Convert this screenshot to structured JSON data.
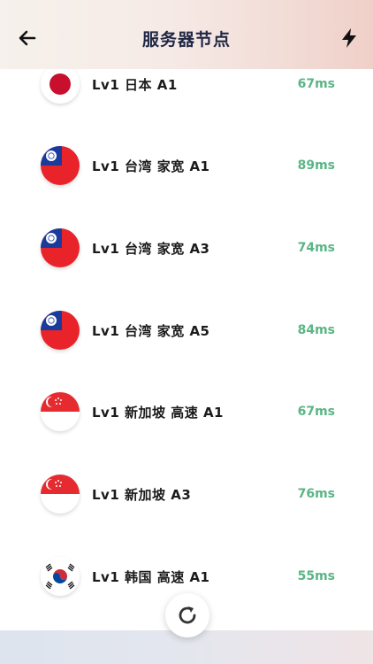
{
  "header": {
    "title": "服务器节点",
    "back_icon": "arrow-left-icon",
    "action_icon": "lightning-bolt-icon"
  },
  "servers": [
    {
      "name": "Lv1 日本 A1",
      "latency": "67ms",
      "flag": "japan-flag-icon"
    },
    {
      "name": "Lv1 台湾 家宽 A1",
      "latency": "89ms",
      "flag": "taiwan-flag-icon"
    },
    {
      "name": "Lv1 台湾 家宽 A3",
      "latency": "74ms",
      "flag": "taiwan-flag-icon"
    },
    {
      "name": "Lv1 台湾 家宽 A5",
      "latency": "84ms",
      "flag": "taiwan-flag-icon"
    },
    {
      "name": "Lv1 新加坡 高速 A1",
      "latency": "67ms",
      "flag": "singapore-flag-icon"
    },
    {
      "name": "Lv1 新加坡 A3",
      "latency": "76ms",
      "flag": "singapore-flag-icon"
    },
    {
      "name": "Lv1 韩国 高速 A1",
      "latency": "55ms",
      "flag": "korea-flag-icon"
    }
  ],
  "refresh_icon": "refresh-icon",
  "colors": {
    "latency": "#5ab585",
    "title": "#1f2746",
    "header_gradient_end": "#efd0c8"
  }
}
